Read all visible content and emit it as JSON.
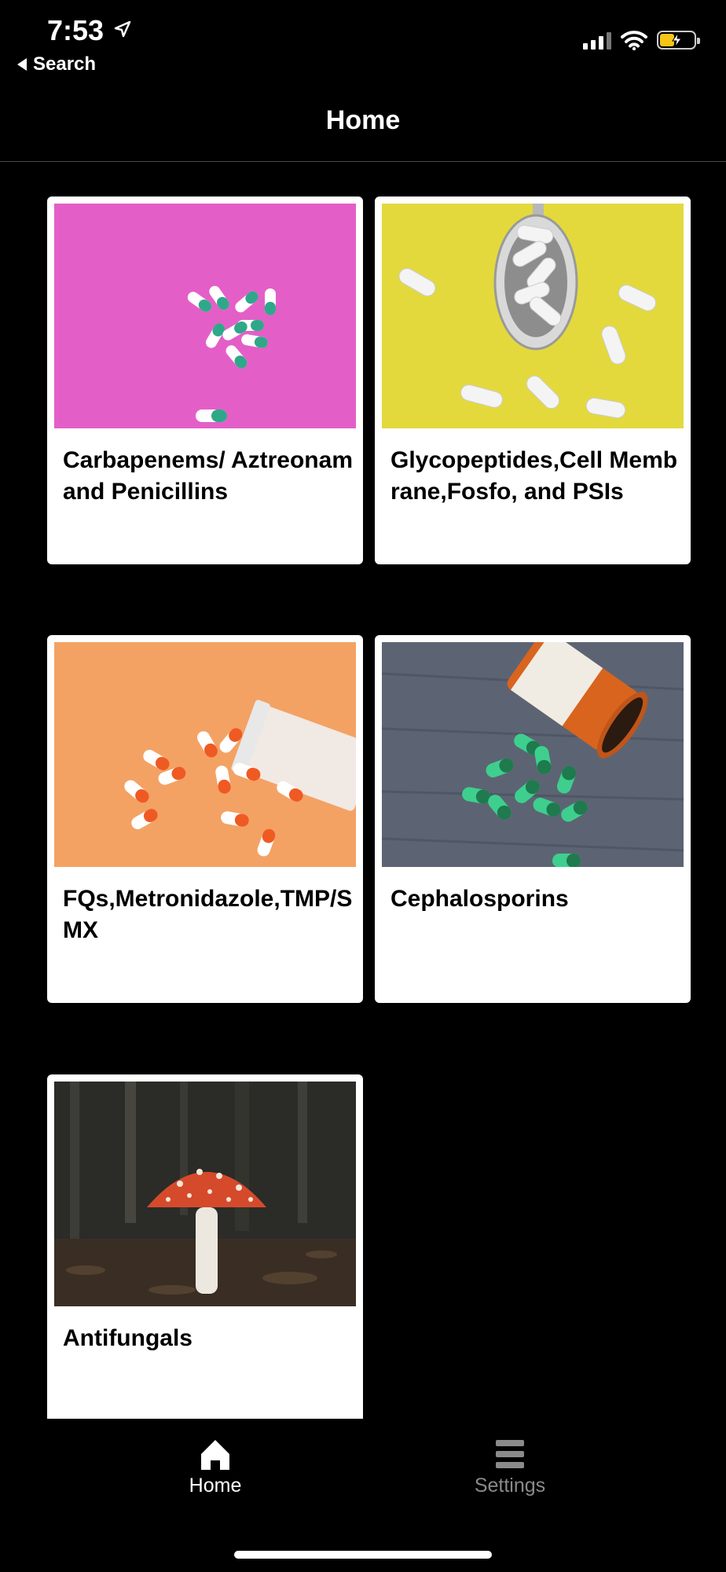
{
  "status_bar": {
    "time": "7:53",
    "back_label": "Search"
  },
  "nav": {
    "title": "Home"
  },
  "cards": [
    {
      "title": "Carbapenems/ Aztreonam and Penicillins",
      "image": "green-white-capsules-on-pink"
    },
    {
      "title": "Glycopeptides,Cell Membrane,Fosfo, and PSIs",
      "image": "white-capsules-spoon-on-yellow"
    },
    {
      "title": "FQs,Metronidazole,TMP/SMX",
      "image": "orange-white-capsules-on-orange"
    },
    {
      "title": "Cephalosporins",
      "image": "green-capsules-spilled-bottle"
    },
    {
      "title": "Antifungals",
      "image": "red-mushroom-forest"
    }
  ],
  "tab_bar": {
    "home_label": "Home",
    "settings_label": "Settings"
  },
  "colors": {
    "background": "#000000",
    "card": "#ffffff",
    "tab_active": "#ffffff",
    "tab_inactive": "#8a8a8a",
    "battery": "#f5c518"
  }
}
